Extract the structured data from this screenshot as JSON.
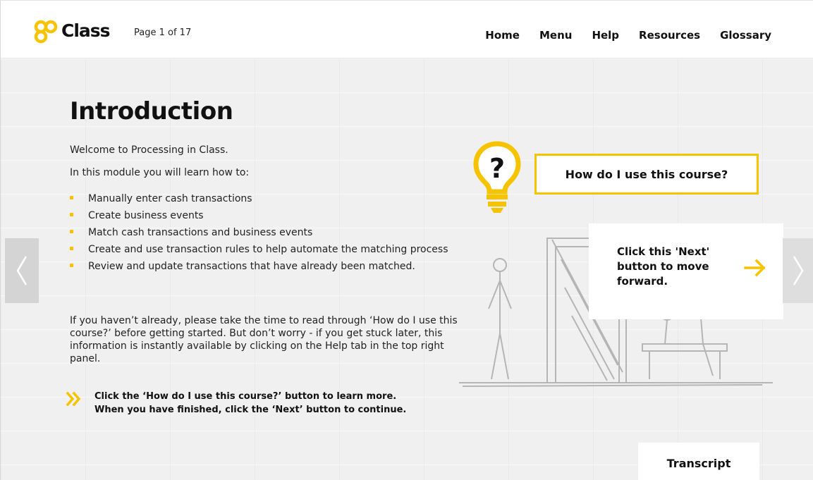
{
  "header": {
    "logo_text": "Class",
    "page_counter": "Page 1 of 17",
    "nav": [
      {
        "label": "Home"
      },
      {
        "label": "Menu"
      },
      {
        "label": "Help"
      },
      {
        "label": "Resources"
      },
      {
        "label": "Glossary"
      }
    ]
  },
  "intro": {
    "title": "Introduction",
    "welcome": "Welcome to Processing in Class.",
    "learn_lead": "In this module you will learn how to:",
    "bullets": [
      "Manually enter cash transactions",
      "Create business events",
      "Match cash transactions and business events",
      "Create and use transaction rules to help automate the matching process",
      "Review and update transactions that have already been matched."
    ],
    "note": "If you haven’t already, please take the time to read through ‘How do I use this course?’ before getting started. But don’t worry - if you get stuck later, this information is instantly available by clicking on the Help tab in the top right panel.",
    "callout_line1": "Click the ‘How do I use this course?’ button to learn more.",
    "callout_line2": "When you have finished, click the ‘Next’ button to continue."
  },
  "course_button": {
    "label": "How do I use this course?"
  },
  "next_hint": {
    "text": "Click this 'Next' button to move forward."
  },
  "transcript": {
    "label": "Transcript"
  },
  "icons": {
    "logo": "class-logo-icon",
    "bulb": "lightbulb-question-icon",
    "arrow": "arrow-right-icon",
    "callout": "double-chevron-right-icon",
    "prev": "chevron-left-icon",
    "next": "chevron-right-icon"
  },
  "colors": {
    "accent": "#f5c300"
  }
}
